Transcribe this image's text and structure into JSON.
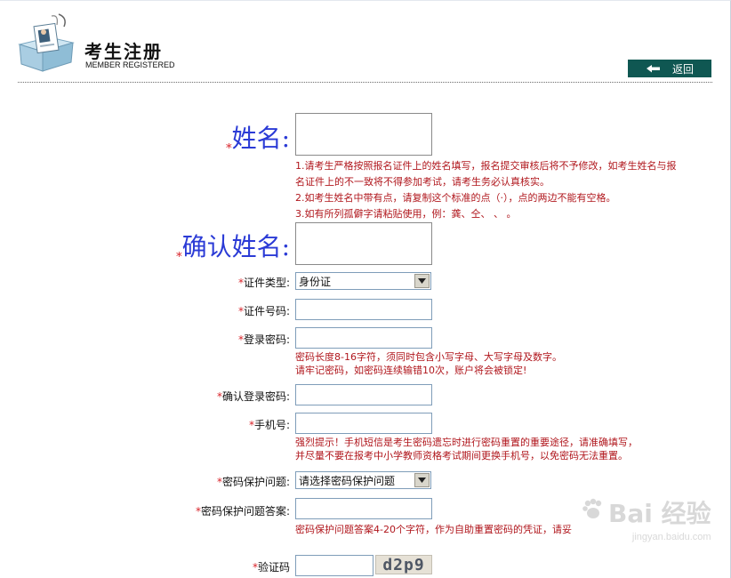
{
  "header": {
    "title": "考生注册",
    "subtitle": "MEMBER REGISTERED",
    "back_label": "返回"
  },
  "form": {
    "required_mark": "*",
    "name": {
      "label": "姓名:",
      "notes": [
        "1.请考生严格按照报名证件上的姓名填写，报名提交审核后将不予修改，如考生姓名与报",
        "名证件上的不一致将不得参加考试，请考生务必认真核实。",
        "2.如考生姓名中带有点，请复制这个标准的点（·），点的两边不能有空格。",
        "3.如有所列孤僻字请粘贴使用，例：龚、仝、    、    。"
      ]
    },
    "confirm_name": {
      "label": "确认姓名:"
    },
    "id_type": {
      "label": "证件类型:",
      "value": "身份证"
    },
    "id_number": {
      "label": "证件号码:"
    },
    "password": {
      "label": "登录密码:",
      "notes": [
        "密码长度8-16字符，须同时包含小写字母、大写字母及数字。",
        "请牢记密码，如密码连续输错10次，账户将会被锁定!"
      ]
    },
    "confirm_password": {
      "label": "确认登录密码:"
    },
    "phone": {
      "label": "手机号:",
      "notes": [
        "强烈提示！手机短信是考生密码遗忘时进行密码重置的重要途径，请准确填写，",
        "并尽量不要在报考中小学教师资格考试期间更换手机号，以免密码无法重置。"
      ]
    },
    "security_question": {
      "label": "密码保护问题:",
      "value": "请选择密码保护问题"
    },
    "security_answer": {
      "label": "密码保护问题答案:",
      "note": "密码保护问题答案4-20个字符，作为自助重置密码的凭证，请妥"
    },
    "captcha": {
      "label": "验证码",
      "image_text": "d2p9"
    }
  },
  "watermark": {
    "text": "Bai 经验",
    "sub": "jingyan.baidu.com"
  },
  "colors": {
    "accent_blue": "#2b3bd6",
    "required_red": "#d8232a",
    "note_red": "#b0161c",
    "button_teal": "#0f5752"
  }
}
